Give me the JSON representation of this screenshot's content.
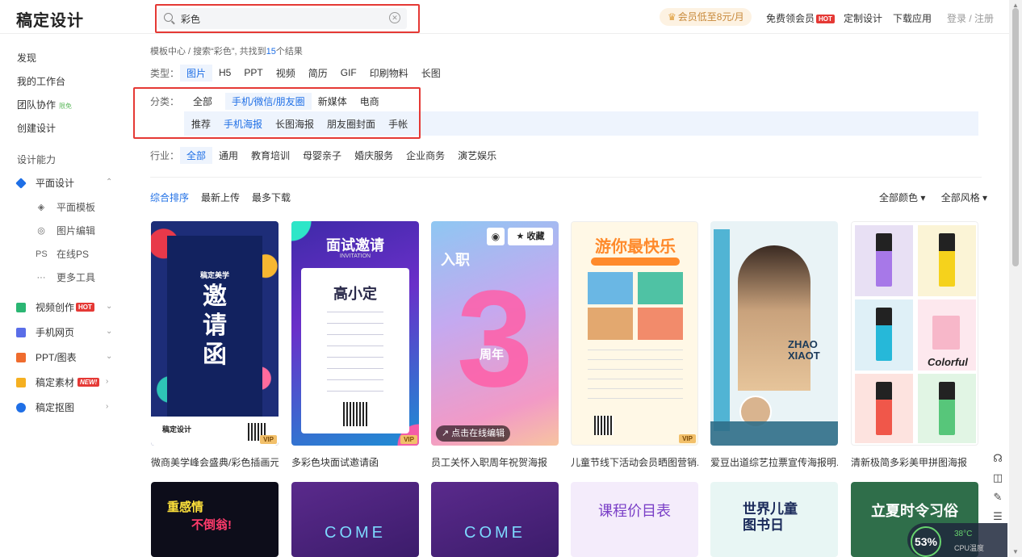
{
  "header": {
    "logo": "稿定设计",
    "search_value": "彩色",
    "vip_promo": "会员低至8元/月",
    "free_vip": "免费领会员",
    "hot": "HOT",
    "custom_design": "定制设计",
    "download_app": "下载应用",
    "login": "登录 / 注册"
  },
  "sidebar": {
    "discover": "发现",
    "workspace": "我的工作台",
    "team": "团队协作",
    "team_badge": "限免",
    "create": "创建设计",
    "section_title": "设计能力",
    "flat_design": "平面设计",
    "subs": [
      "平面模板",
      "图片编辑",
      "在线PS",
      "更多工具"
    ],
    "sub_icons": [
      "◈",
      "◎",
      "PS",
      "···"
    ],
    "video": "视频创作",
    "video_badge": "HOT",
    "h5": "手机网页",
    "ppt": "PPT/图表",
    "material": "稿定素材",
    "material_badge": "NEW!",
    "cutout": "稿定抠图"
  },
  "main": {
    "breadcrumb_prefix": "模板中心 / 搜索“彩色”, 共找到",
    "breadcrumb_count": "15",
    "breadcrumb_suffix": "个结果",
    "type_label": "类型：",
    "types": [
      "图片",
      "H5",
      "PPT",
      "视频",
      "简历",
      "GIF",
      "印刷物料",
      "长图"
    ],
    "category_label": "分类：",
    "categories": [
      "全部",
      "手机/微信/朋友圈",
      "新媒体",
      "电商"
    ],
    "subcategories": [
      "推荐",
      "手机海报",
      "长图海报",
      "朋友圈封面",
      "手帐"
    ],
    "industry_label": "行业：",
    "industries": [
      "全部",
      "通用",
      "教育培训",
      "母婴亲子",
      "婚庆服务",
      "企业商务",
      "演艺娱乐"
    ],
    "sorts": [
      "综合排序",
      "最新上传",
      "最多下载"
    ],
    "color_filter": "全部颜色 ▾",
    "style_filter": "全部风格 ▾"
  },
  "cards": [
    {
      "title": "微商美学峰会盛典/彩色插画元...",
      "vip": "VIP",
      "text1": "稿定美学",
      "text2": "邀",
      "text3": "请",
      "text4": "函",
      "text5": "稿定设计"
    },
    {
      "title": "多彩色块面试邀请函",
      "vip": "VIP",
      "text1": "面试邀请",
      "text2": "INVITATION",
      "text3": "高小定"
    },
    {
      "title": "员工关怀入职周年祝贺海报",
      "text1": "入职",
      "text2": "3",
      "text3": "周年",
      "text4": "↗ 点击在线编辑",
      "collect": "★ 收藏"
    },
    {
      "title": "儿童节线下活动会员晒图营销...",
      "vip": "VIP",
      "text1": "游你最快乐"
    },
    {
      "title": "爱豆出道综艺拉票宣传海报明...",
      "text1": "ZHAO",
      "text2": "XIAOT"
    },
    {
      "title": "清新极简多彩美甲拼图海报",
      "text1": "Colorful"
    }
  ],
  "cards_row2": [
    {
      "text1": "重感情",
      "text2": "不倒翁!"
    },
    {
      "text1": "COME"
    },
    {
      "text1": "COME"
    },
    {
      "text1": "课程价目表"
    },
    {
      "text1": "世界儿童",
      "text2": "图书日"
    },
    {
      "text1": "立夏时令习俗"
    }
  ],
  "widget": {
    "cpu_percent": "53%",
    "cpu_temp": "38°C",
    "cpu_label": "CPU温度"
  }
}
